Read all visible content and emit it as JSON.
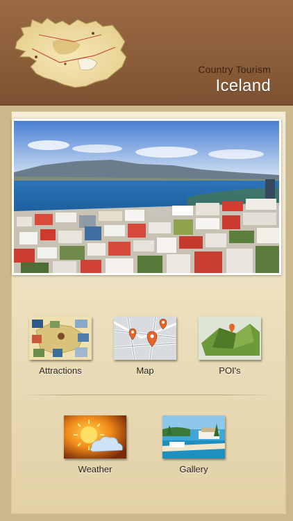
{
  "header": {
    "subtitle": "Country Tourism",
    "title": "Iceland",
    "map_icon": "iceland-map-icon"
  },
  "hero": {
    "image": "reykjavik-city-photo"
  },
  "menu": {
    "attractions": "Attractions",
    "map": "Map",
    "pois": "POI's",
    "weather": "Weather",
    "gallery": "Gallery"
  },
  "colors": {
    "header_brown": "#8a5c38",
    "panel_cream": "#ece0bf",
    "label_text": "#2b2218"
  }
}
